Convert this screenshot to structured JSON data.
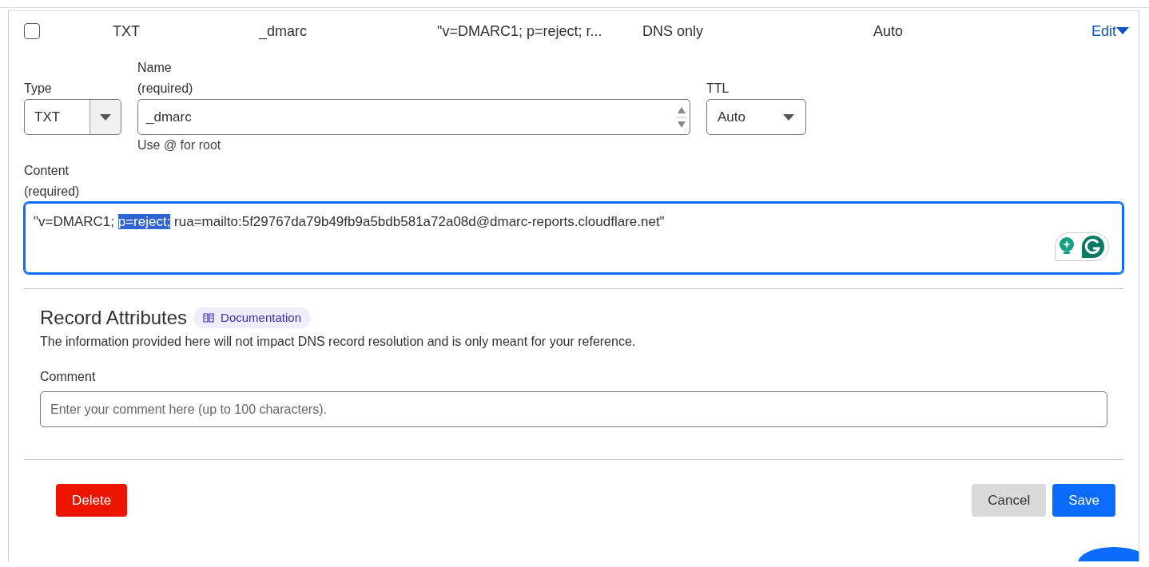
{
  "record_row": {
    "checked": false,
    "cells": [
      "TXT",
      "_dmarc",
      "\"v=DMARC1; p=reject; r...",
      "DNS only",
      "Auto"
    ],
    "edit_link": "Edit",
    "expanded": true
  },
  "form": {
    "type": {
      "label": "Type",
      "value": "TXT"
    },
    "name": {
      "label": "Name",
      "required": "(required)",
      "value": "_dmarc",
      "hint": "Use @ for root"
    },
    "ttl": {
      "label": "TTL",
      "value": "Auto"
    },
    "content": {
      "label": "Content",
      "required": "(required)",
      "segments": [
        {
          "text": "\"v=DMARC1; ",
          "selected": false
        },
        {
          "text": "p=reject;",
          "selected": true
        },
        {
          "text": " rua=mailto:5f29767da79b49fb9a5bdb581a72a08d@dmarc-reports.cloudflare.net\"",
          "selected": false
        }
      ]
    }
  },
  "attributes": {
    "title": "Record Attributes",
    "doc_badge": "Documentation",
    "description": "The information provided here will not impact DNS record resolution and is only meant for your reference.",
    "comment_label": "Comment",
    "comment_placeholder": "Enter your comment here (up to 100 characters)."
  },
  "buttons": [
    {
      "label": "Delete",
      "kind": "danger"
    },
    {
      "label": "Cancel",
      "kind": "secondary"
    },
    {
      "label": "Save",
      "kind": "primary"
    }
  ]
}
